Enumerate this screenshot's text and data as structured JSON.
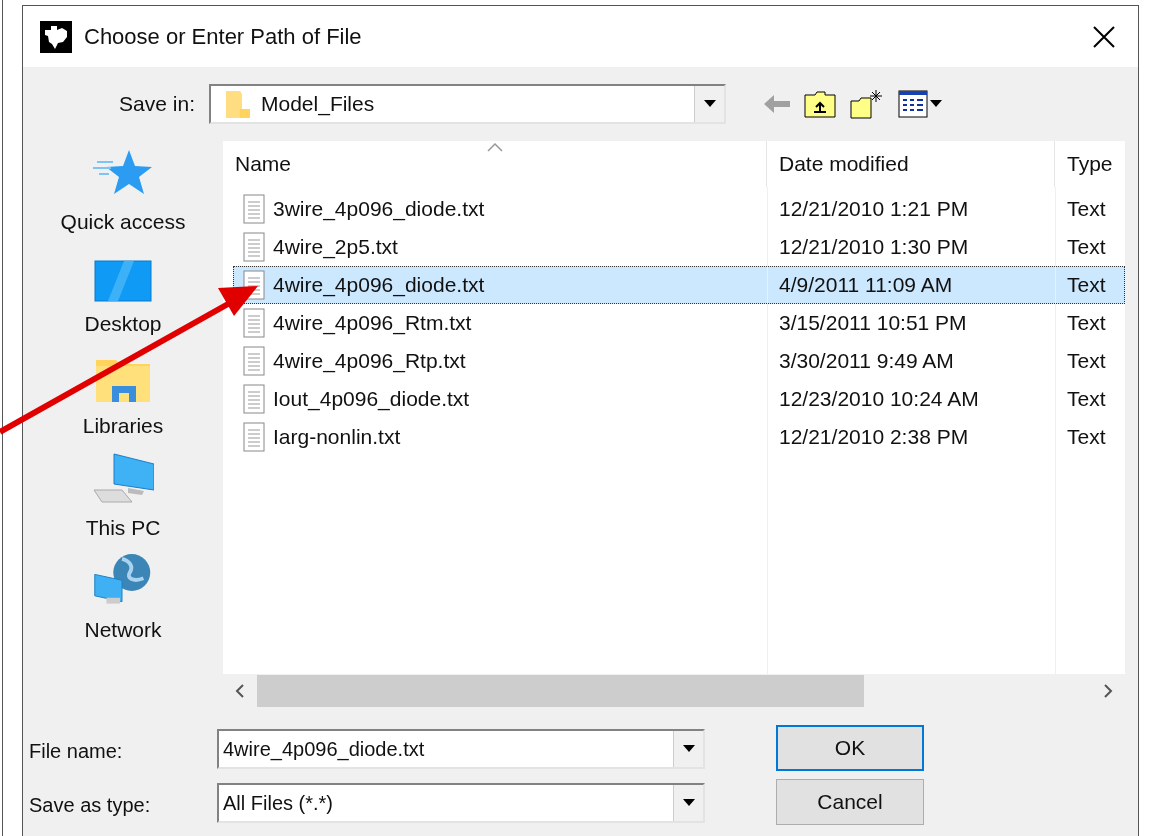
{
  "window": {
    "title": "Choose or Enter Path of File"
  },
  "save_in": {
    "label": "Save in:",
    "value": "Model_Files"
  },
  "places": [
    {
      "label": "Quick access",
      "kind": "star"
    },
    {
      "label": "Desktop",
      "kind": "desktop"
    },
    {
      "label": "Libraries",
      "kind": "library"
    },
    {
      "label": "This PC",
      "kind": "computer"
    },
    {
      "label": "Network",
      "kind": "network"
    }
  ],
  "columns": [
    {
      "label": "Name",
      "sorted": true
    },
    {
      "label": "Date modified",
      "sorted": false
    },
    {
      "label": "Type",
      "sorted": false
    }
  ],
  "files": [
    {
      "name": "3wire_4p096_diode.txt",
      "date": "12/21/2010 1:21 PM",
      "type": "Text",
      "selected": false
    },
    {
      "name": "4wire_2p5.txt",
      "date": "12/21/2010 1:30 PM",
      "type": "Text",
      "selected": false
    },
    {
      "name": "4wire_4p096_diode.txt",
      "date": "4/9/2011 11:09 AM",
      "type": "Text",
      "selected": true
    },
    {
      "name": "4wire_4p096_Rtm.txt",
      "date": "3/15/2011 10:51 PM",
      "type": "Text",
      "selected": false
    },
    {
      "name": "4wire_4p096_Rtp.txt",
      "date": "3/30/2011 9:49 AM",
      "type": "Text",
      "selected": false
    },
    {
      "name": "Iout_4p096_diode.txt",
      "date": "12/23/2010 10:24 AM",
      "type": "Text",
      "selected": false
    },
    {
      "name": "Iarg-nonlin.txt",
      "date": "12/21/2010 2:38 PM",
      "type": "Text",
      "selected": false
    }
  ],
  "file_name": {
    "label": "File name:",
    "value": "4wire_4p096_diode.txt"
  },
  "file_type": {
    "label": "Save as type:",
    "value": "All Files (*.*)"
  },
  "buttons": [
    "OK",
    "Cancel"
  ]
}
